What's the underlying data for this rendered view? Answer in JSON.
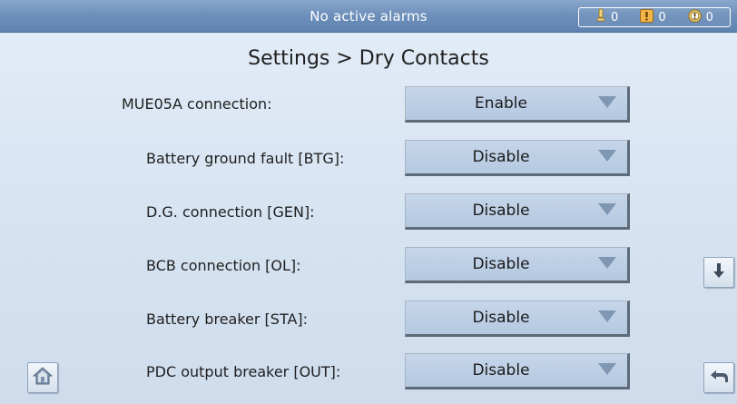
{
  "status_bar": {
    "alarm_status": "No active alarms",
    "minor_alarm_count": "0",
    "major_alarm_count": "0",
    "critical_alarm_count": "0",
    "minor_alarm_icon": "minor-alarm-icon",
    "major_alarm_icon": "major-alarm-icon",
    "critical_alarm_icon": "critical-alarm-icon"
  },
  "page": {
    "title": "Settings > Dry Contacts"
  },
  "settings": [
    {
      "label": "MUE05A connection:",
      "value": "Enable"
    },
    {
      "label": "Battery ground fault [BTG]:",
      "value": "Disable"
    },
    {
      "label": "D.G. connection [GEN]:",
      "value": "Disable"
    },
    {
      "label": "BCB connection [OL]:",
      "value": "Disable"
    },
    {
      "label": "Battery breaker [STA]:",
      "value": "Disable"
    },
    {
      "label": "PDC output breaker [OUT]:",
      "value": "Disable"
    }
  ],
  "navigation": {
    "home_icon": "home-icon",
    "scroll_down_icon": "arrow-down-icon",
    "back_icon": "back-arrow-icon"
  },
  "colors": {
    "header_bar": "#6e90bb",
    "background": "#d6e3f1",
    "dropdown_fill": "#b4c8e0",
    "dropdown_arrow": "#7f97b3"
  }
}
